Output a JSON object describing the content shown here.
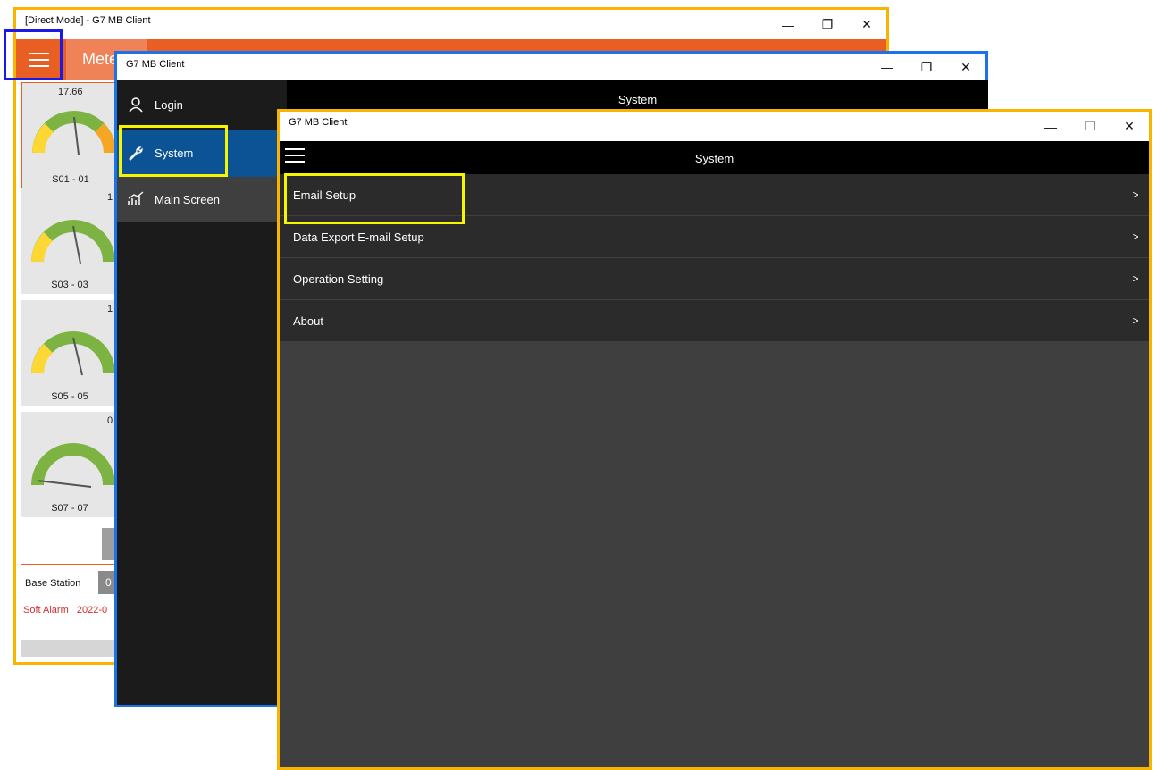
{
  "window1": {
    "title": "[Direct Mode] - G7 MB Client",
    "header_label": "Mete",
    "gauges": [
      {
        "value": "17.66",
        "label": "S01 - 01"
      },
      {
        "value": "1",
        "label": "S03 - 03"
      },
      {
        "value": "1",
        "label": "S05 - 05"
      },
      {
        "value": "0",
        "label": "S07 - 07"
      }
    ],
    "base_station_label": "Base Station",
    "base_station_value": "0",
    "alarm_text": "Soft Alarm   2022-0",
    "colors": {
      "accent": "#e95e23",
      "alarm": "#d32f2f"
    }
  },
  "window2": {
    "title": "G7 MB Client",
    "header_title": "System",
    "nav": [
      {
        "label": "Login",
        "icon": "user-icon"
      },
      {
        "label": "System",
        "icon": "wrench-icon"
      },
      {
        "label": "Main Screen",
        "icon": "chart-icon"
      }
    ],
    "colors": {
      "selected": "#0b5394"
    }
  },
  "window3": {
    "title": "G7 MB Client",
    "header_title": "System",
    "menu": [
      {
        "label": "Email Setup",
        "chevron": ">"
      },
      {
        "label": "Data Export E-mail Setup",
        "chevron": ">"
      },
      {
        "label": "Operation Setting",
        "chevron": ">"
      },
      {
        "label": "About",
        "chevron": ">"
      }
    ]
  },
  "window_controls": {
    "minimize": "—",
    "maximize": "❐",
    "close": "✕"
  }
}
